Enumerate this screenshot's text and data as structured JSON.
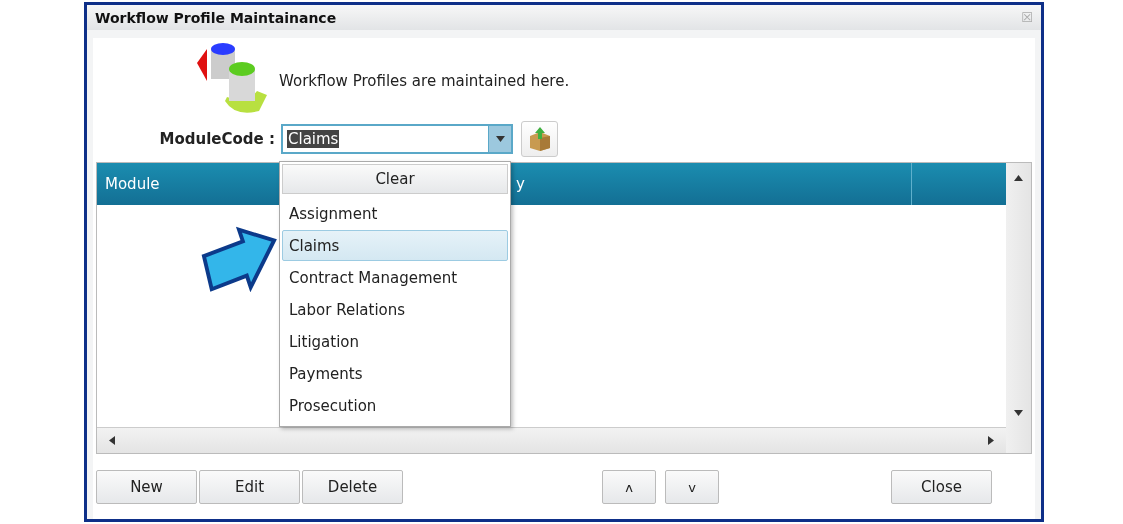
{
  "window": {
    "title": "Workflow Profile Maintainance",
    "close": "☒"
  },
  "description": "Workflow Profiles are maintained here.",
  "module_code": {
    "label": "ModuleCode :",
    "value": "Claims",
    "expanded": true
  },
  "dropdown": {
    "clear_button": "Clear",
    "items": [
      {
        "label": "Assignment",
        "selected": false
      },
      {
        "label": "Claims",
        "selected": true
      },
      {
        "label": "Contract Management",
        "selected": false
      },
      {
        "label": "Labor Relations",
        "selected": false
      },
      {
        "label": "Litigation",
        "selected": false
      },
      {
        "label": "Payments",
        "selected": false
      },
      {
        "label": "Prosecution",
        "selected": false
      }
    ]
  },
  "table": {
    "columns": [
      {
        "label": "Module"
      },
      {
        "label": "y"
      }
    ]
  },
  "left_buttons": [
    "New",
    "Edit",
    "Delete"
  ],
  "move_buttons": [
    "ʌ",
    "v"
  ],
  "close_button": "Close"
}
